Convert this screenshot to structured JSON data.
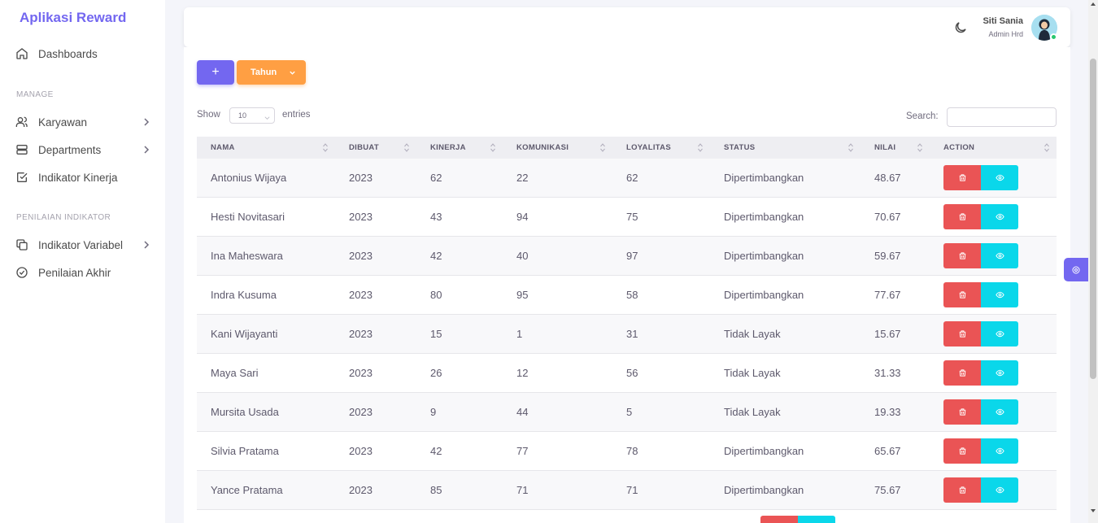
{
  "app": {
    "title": "Aplikasi Reward"
  },
  "sidebar": {
    "dashboards": "Dashboards",
    "section_manage": "MANAGE",
    "karyawan": "Karyawan",
    "departments": "Departments",
    "indikator_kinerja": "Indikator Kinerja",
    "section_penilaian": "PENILAIAN INDIKATOR",
    "indikator_variabel": "Indikator Variabel",
    "penilaian_akhir": "Penilaian Akhir"
  },
  "navbar": {
    "user_name": "Siti Sania",
    "user_role": "Admin Hrd"
  },
  "toolbar": {
    "add_label": "+",
    "year_label": "Tahun"
  },
  "table_controls": {
    "show_label": "Show",
    "entries_value": "10",
    "entries_label": "entries",
    "search_label": "Search:"
  },
  "table": {
    "headers": [
      "NAMA",
      "DIBUAT",
      "KINERJA",
      "KOMUNIKASI",
      "LOYALITAS",
      "STATUS",
      "NILAI",
      "ACTION"
    ],
    "rows": [
      [
        "Antonius Wijaya",
        "2023",
        "62",
        "22",
        "62",
        "Dipertimbangkan",
        "48.67"
      ],
      [
        "Hesti Novitasari",
        "2023",
        "43",
        "94",
        "75",
        "Dipertimbangkan",
        "70.67"
      ],
      [
        "Ina Maheswara",
        "2023",
        "42",
        "40",
        "97",
        "Dipertimbangkan",
        "59.67"
      ],
      [
        "Indra Kusuma",
        "2023",
        "80",
        "95",
        "58",
        "Dipertimbangkan",
        "77.67"
      ],
      [
        "Kani Wijayanti",
        "2023",
        "15",
        "1",
        "31",
        "Tidak Layak",
        "15.67"
      ],
      [
        "Maya Sari",
        "2023",
        "26",
        "12",
        "56",
        "Tidak Layak",
        "31.33"
      ],
      [
        "Mursita Usada",
        "2023",
        "9",
        "44",
        "5",
        "Tidak Layak",
        "19.33"
      ],
      [
        "Silvia Pratama",
        "2023",
        "42",
        "77",
        "78",
        "Dipertimbangkan",
        "65.67"
      ],
      [
        "Yance Pratama",
        "2023",
        "85",
        "71",
        "71",
        "Dipertimbangkan",
        "75.67"
      ]
    ]
  },
  "colors": {
    "primary": "#7367f0",
    "warning": "#ff9f43",
    "danger": "#ea5455",
    "info": "#0ad7ea",
    "success": "#28c76f"
  }
}
